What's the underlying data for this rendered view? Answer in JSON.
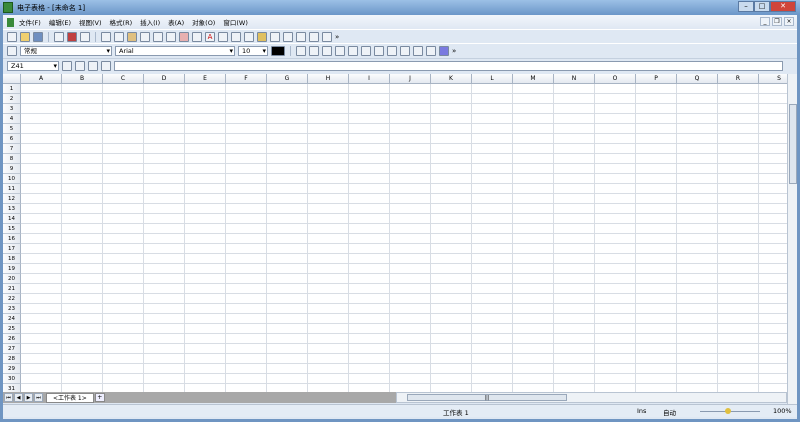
{
  "title": "电子表格 - [未命名 1]",
  "menu": [
    "文件(F)",
    "编辑(E)",
    "视图(V)",
    "格式(R)",
    "插入(I)",
    "表(A)",
    "对象(O)",
    "窗口(W)"
  ],
  "toolbar2": {
    "style": "常规",
    "font": "Arial",
    "size": "10"
  },
  "formula": {
    "cell_ref": "Z41",
    "value": ""
  },
  "columns": [
    "A",
    "B",
    "C",
    "D",
    "E",
    "F",
    "G",
    "H",
    "I",
    "J",
    "K",
    "L",
    "M",
    "N",
    "O",
    "P",
    "Q",
    "R",
    "S"
  ],
  "row_count": 31,
  "sheet_tab": "<工作表 1>",
  "add_tab": "+",
  "status": {
    "sheet": "工作表 1",
    "mode": "Ins",
    "calc": "自动",
    "zoom": "100%"
  },
  "zoom_level": 1.0
}
